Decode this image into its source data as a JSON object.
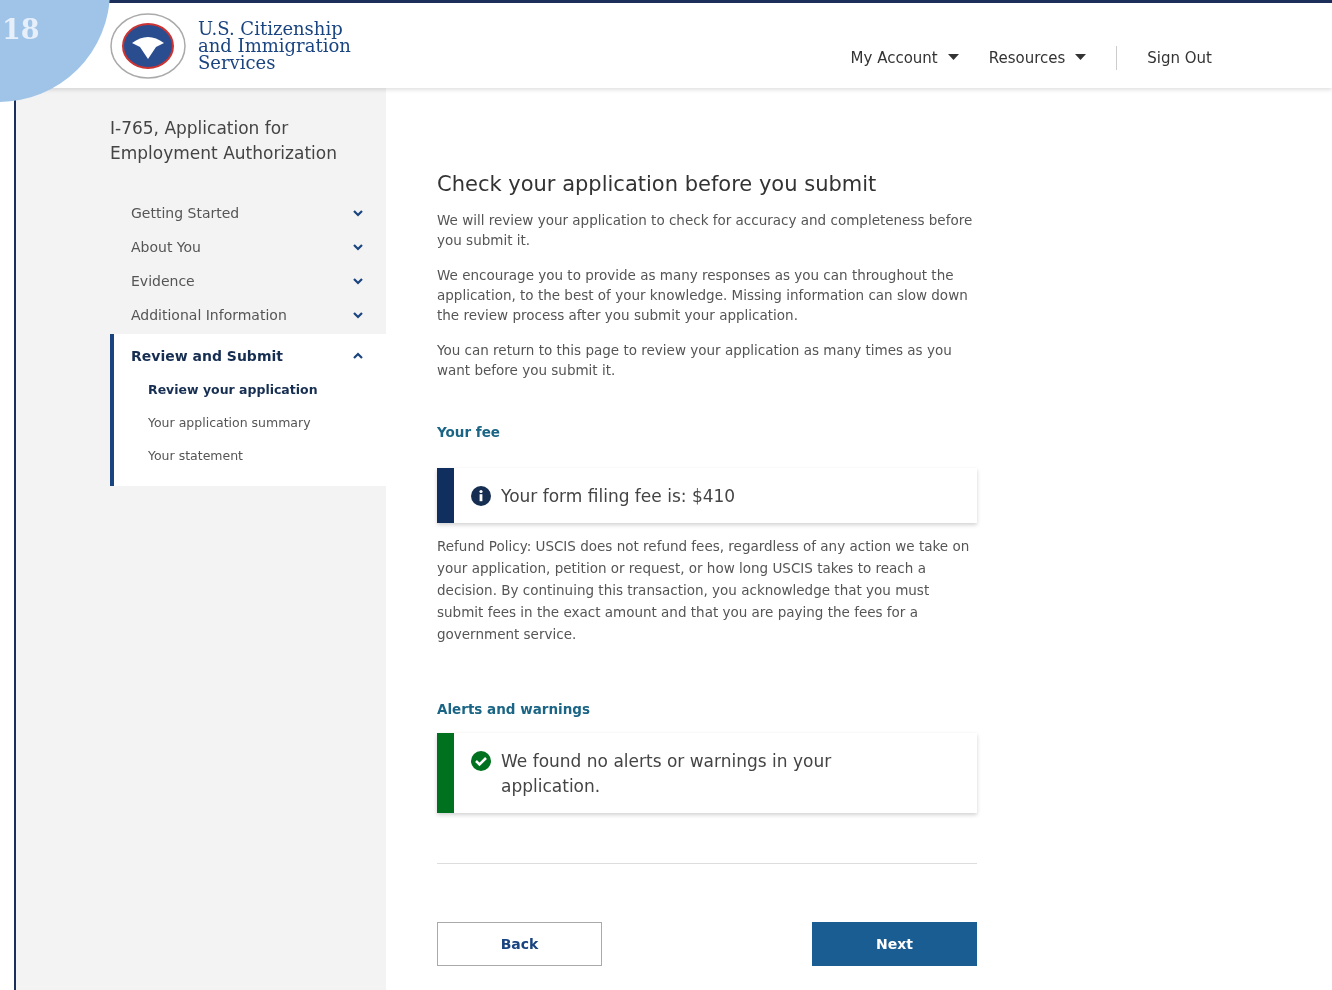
{
  "page_badge": "18",
  "header": {
    "agency": [
      "U.S. Citizenship",
      "and Immigration",
      "Services"
    ],
    "nav": [
      {
        "label": "My Account",
        "kind": "dropdown"
      },
      {
        "label": "Resources",
        "kind": "dropdown"
      },
      {
        "label": "Sign Out",
        "kind": "link"
      }
    ]
  },
  "sidebar": {
    "title": "I-765, Application for Employment Authorization",
    "sections": [
      {
        "label": "Getting Started",
        "expanded": false,
        "selected": false
      },
      {
        "label": "About You",
        "expanded": false,
        "selected": false
      },
      {
        "label": "Evidence",
        "expanded": false,
        "selected": false
      },
      {
        "label": "Additional Information",
        "expanded": false,
        "selected": false
      },
      {
        "label": "Review and Submit",
        "expanded": true,
        "selected": true,
        "children": [
          {
            "label": "Review your application",
            "selected": true
          },
          {
            "label": "Your application summary",
            "selected": false
          },
          {
            "label": "Your statement",
            "selected": false
          }
        ]
      }
    ]
  },
  "main": {
    "heading": "Check your application before you submit",
    "paragraphs": [
      "We will review your application to check for accuracy and completeness before you submit it.",
      "We encourage you to provide as many responses as you can throughout the application, to the best of your knowledge. Missing information can slow down the review process after you submit your application.",
      "You can return to this page to review your application as many times as you want before you submit it."
    ],
    "fee_heading": "Your fee",
    "fee_alert": {
      "kind": "info",
      "text": "Your form filing fee is: $410"
    },
    "refund_policy": "Refund Policy: USCIS does not refund fees, regardless of any action we take on your application, petition or request, or how long USCIS takes to reach a decision. By continuing this transaction, you acknowledge that you must submit fees in the exact amount and that you are paying the fees for a government service.",
    "alerts_heading": "Alerts and warnings",
    "alerts_alert": {
      "kind": "success",
      "text": "We found no alerts or warnings in your application."
    },
    "buttons": [
      {
        "label": "Back",
        "kind": "secondary"
      },
      {
        "label": "Next",
        "kind": "primary"
      }
    ]
  }
}
